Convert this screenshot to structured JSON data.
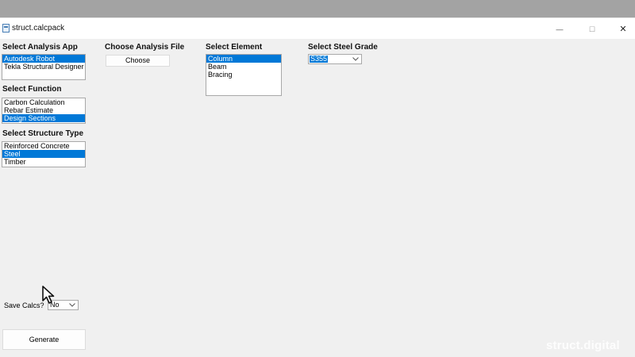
{
  "window": {
    "title": "struct.calcpack"
  },
  "controls": {
    "minimize": "—",
    "maximize": "☐",
    "close": "✕"
  },
  "analysis_app": {
    "heading": "Select Analysis App",
    "items": [
      {
        "label": "Autodesk Robot",
        "selected": true
      },
      {
        "label": "Tekla Structural Designer",
        "selected": false
      }
    ]
  },
  "function": {
    "heading": "Select Function",
    "items": [
      {
        "label": "Carbon Calculation",
        "selected": false
      },
      {
        "label": "Rebar Estimate",
        "selected": false
      },
      {
        "label": "Design Sections",
        "selected": true
      }
    ]
  },
  "structure_type": {
    "heading": "Select Structure Type",
    "items": [
      {
        "label": "Reinforced Concrete",
        "selected": false
      },
      {
        "label": "Steel",
        "selected": true
      },
      {
        "label": "Timber",
        "selected": false
      }
    ]
  },
  "analysis_file": {
    "heading": "Choose Analysis File",
    "button": "Choose"
  },
  "element": {
    "heading": "Select Element",
    "items": [
      {
        "label": "Column",
        "selected": true
      },
      {
        "label": "Beam",
        "selected": false
      },
      {
        "label": "Bracing",
        "selected": false
      }
    ]
  },
  "steel_grade": {
    "heading": "Select Steel Grade",
    "value": "S355"
  },
  "save_calcs": {
    "label": "Save Calcs?",
    "value": "No"
  },
  "generate": {
    "label": "Generate"
  },
  "watermark": "struct.digital",
  "colors": {
    "selection": "#0078d7",
    "window_bg": "#f0f0f0"
  }
}
